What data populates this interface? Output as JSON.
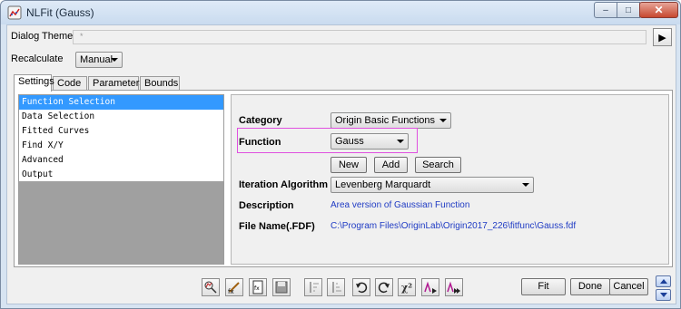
{
  "window": {
    "title": "NLFit (Gauss)",
    "close_glyph": "✕",
    "minimize_glyph": "–",
    "maximize_glyph": "□"
  },
  "dialog_theme": {
    "label": "Dialog Theme",
    "value": "*",
    "arrow_glyph": "▶"
  },
  "recalculate": {
    "label": "Recalculate",
    "value": "Manual"
  },
  "tabs": [
    {
      "label": "Settings",
      "active": true
    },
    {
      "label": "Code"
    },
    {
      "label": "Parameters"
    },
    {
      "label": "Bounds"
    }
  ],
  "tree": {
    "items": [
      {
        "label": "Function Selection",
        "selected": true
      },
      {
        "label": "Data Selection"
      },
      {
        "label": "Fitted Curves"
      },
      {
        "label": "Find X/Y"
      },
      {
        "label": "Advanced"
      },
      {
        "label": "Output"
      }
    ]
  },
  "form": {
    "category": {
      "label": "Category",
      "value": "Origin Basic Functions"
    },
    "function": {
      "label": "Function",
      "value": "Gauss"
    },
    "buttons": {
      "new": "New",
      "add": "Add",
      "search": "Search"
    },
    "iteration": {
      "label": "Iteration Algorithm",
      "value": "Levenberg Marquardt"
    },
    "description": {
      "label": "Description",
      "value": "Area version of Gaussian Function"
    },
    "file_name": {
      "label": "File Name(.FDF)",
      "value": "C:\\Program Files\\OriginLab\\Origin2017_226\\fitfunc\\Gauss.fdf"
    }
  },
  "toolbar": {
    "icons": [
      "fit-preview-icon",
      "fx-edit-icon",
      "fx-file-icon",
      "save-icon",
      "sort-asc-icon",
      "sort-desc-icon",
      "undo-fit-icon",
      "reset-icon",
      "chi-square-icon",
      "one-iteration-icon",
      "fit-until-converged-icon"
    ],
    "chi_label": "χ²",
    "fit": "Fit",
    "done": "Done",
    "cancel": "Cancel"
  },
  "colors": {
    "selection": "#3399ff",
    "link_text": "#1f3bc4",
    "highlight_border": "#e050e0"
  }
}
